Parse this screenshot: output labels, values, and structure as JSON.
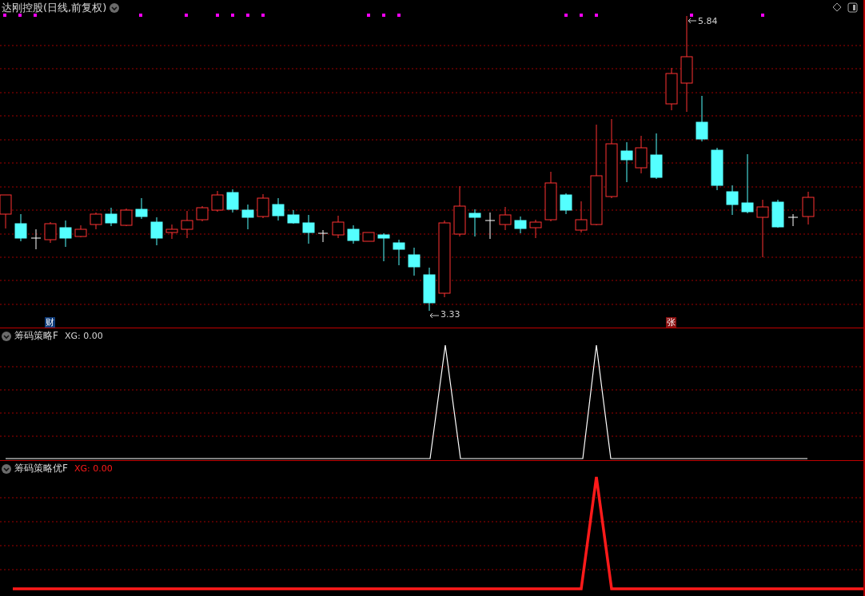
{
  "main": {
    "title": "达刚控股(日线,前复权)",
    "price_labels": [
      {
        "text": "5.84",
        "kind": "high"
      },
      {
        "text": "3.33",
        "kind": "low"
      }
    ],
    "badges": [
      {
        "text": "财",
        "color": "#0f3c7a"
      },
      {
        "text": "张",
        "color": "#8a0f0f"
      }
    ]
  },
  "indicators": [
    {
      "name": "筹码策略F",
      "reading": "XG: 0.00",
      "color": "#ffffff"
    },
    {
      "name": "筹码策略优F",
      "reading": "XG: 0.00",
      "color": "#ff1a1a"
    }
  ]
}
